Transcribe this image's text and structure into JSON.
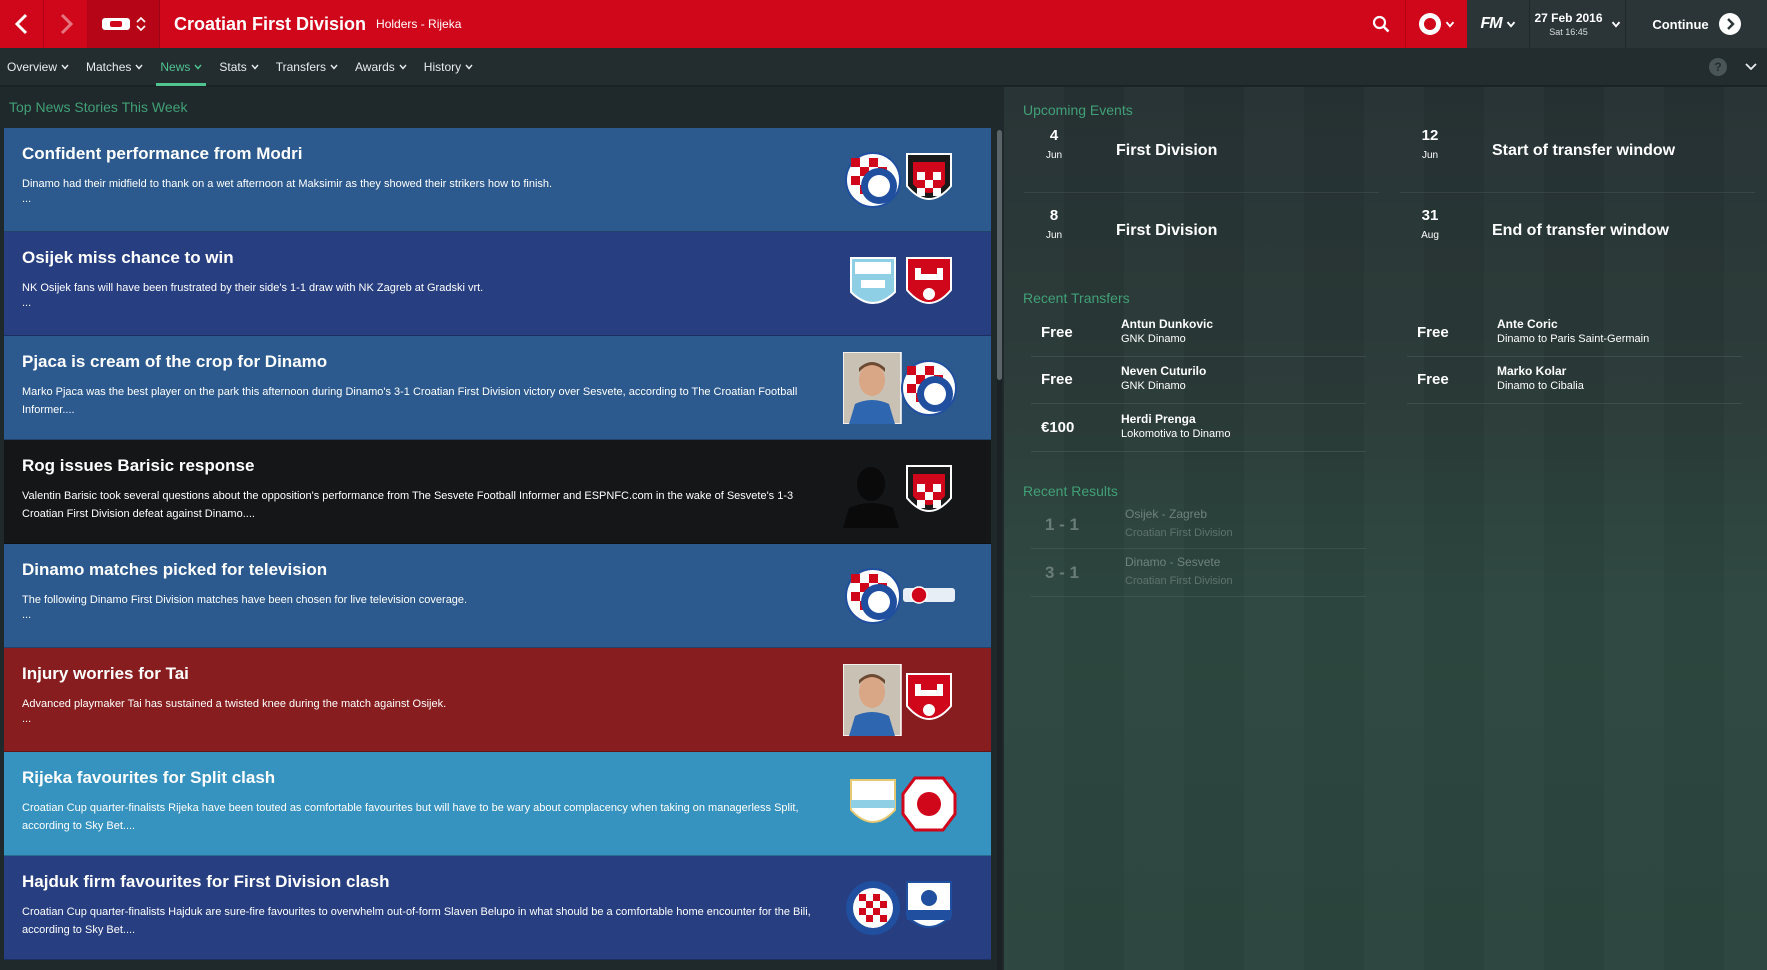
{
  "colors": {
    "accent_red": "#d0061b",
    "accent_green": "#41a077"
  },
  "header": {
    "title": "Croatian First Division",
    "subtitle": "Holders - Rijeka",
    "date": "27 Feb 2016",
    "time": "Sat 16:45",
    "continue_label": "Continue",
    "logo_text": "FM"
  },
  "tabs": [
    {
      "label": "Overview"
    },
    {
      "label": "Matches"
    },
    {
      "label": "News",
      "active": true
    },
    {
      "label": "Stats"
    },
    {
      "label": "Transfers"
    },
    {
      "label": "Awards"
    },
    {
      "label": "History"
    }
  ],
  "help_label": "?",
  "news": {
    "title": "Top News Stories This Week",
    "items": [
      {
        "headline": "Confident performance from Modri",
        "body": "Dinamo had their midfield to thank on a wet afternoon at Maksimir as they showed their strikers how to finish.",
        "more": "...",
        "color": "#2c5a8e",
        "images": [
          "dinamo-crest",
          "sesvete-crest"
        ]
      },
      {
        "headline": "Osijek miss chance to win",
        "body": "NK Osijek fans will have been frustrated by their side's 1-1 draw with NK Zagreb at Gradski vrt.",
        "more": "...",
        "color": "#273e80",
        "images": [
          "osijek-crest",
          "zagreb-crest"
        ]
      },
      {
        "headline": "Pjaca is cream of the crop for Dinamo",
        "body": "Marko Pjaca was the best player on the park this afternoon during Dinamo's 3-1 Croatian First Division victory over Sesvete, according to The Croatian Football Informer....",
        "more": "",
        "color": "#2c5a8e",
        "images": [
          "player-photo",
          "dinamo-crest"
        ]
      },
      {
        "headline": "Rog issues Barisic response",
        "body": "Valentin Barisic took several questions about the opposition's performance from The Sesvete Football Informer and ESPNFC.com in the wake of Sesvete's 1-3 Croatian First Division defeat against Dinamo....",
        "more": "",
        "color": "#151617",
        "images": [
          "silhouette",
          "sesvete-crest"
        ]
      },
      {
        "headline": "Dinamo matches picked for television",
        "body": "The following Dinamo First Division matches have been chosen for live television coverage.",
        "more": "...",
        "color": "#2c5a8e",
        "images": [
          "dinamo-crest",
          "tv-logo"
        ]
      },
      {
        "headline": "Injury worries for Tai",
        "body": "Advanced playmaker Tai has sustained a twisted knee during the match against Osijek.",
        "more": "...",
        "color": "#881d1f",
        "images": [
          "player-photo",
          "zagreb-crest"
        ]
      },
      {
        "headline": "Rijeka favourites for Split clash",
        "body": "Croatian Cup quarter-finalists Rijeka have been touted as comfortable favourites but will have to be wary about complacency when taking on managerless Split, according to Sky Bet....",
        "more": "",
        "color": "#3692bf",
        "images": [
          "rijeka-crest",
          "split-crest"
        ]
      },
      {
        "headline": "Hajduk firm favourites for First Division clash",
        "body": "Croatian Cup quarter-finalists Hajduk are sure-fire favourites to overwhelm out-of-form Slaven Belupo in what should be a comfortable home encounter for the Bili, according to Sky Bet....",
        "more": "",
        "color": "#273e80",
        "images": [
          "hajduk-crest",
          "slaven-crest"
        ]
      }
    ]
  },
  "events": {
    "title": "Upcoming Events",
    "items": [
      {
        "day": "4",
        "month": "Jun",
        "name": "First Division"
      },
      {
        "day": "12",
        "month": "Jun",
        "name": "Start of transfer window"
      },
      {
        "day": "8",
        "month": "Jun",
        "name": "First Division"
      },
      {
        "day": "31",
        "month": "Aug",
        "name": "End of transfer window"
      }
    ]
  },
  "transfers": {
    "title": "Recent Transfers",
    "items": [
      {
        "fee": "Free",
        "player": "Antun Dunkovic",
        "detail": "GNK Dinamo"
      },
      {
        "fee": "Free",
        "player": "Ante Coric",
        "detail": "Dinamo to Paris Saint-Germain"
      },
      {
        "fee": "Free",
        "player": "Neven Cuturilo",
        "detail": "GNK Dinamo"
      },
      {
        "fee": "Free",
        "player": "Marko Kolar",
        "detail": "Dinamo to Cibalia"
      },
      {
        "fee": "€100",
        "player": "Herdi Prenga",
        "detail": "Lokomotiva to Dinamo"
      }
    ]
  },
  "results": {
    "title": "Recent Results",
    "items": [
      {
        "score": "1 - 1",
        "teams": "Osijek - Zagreb",
        "competition": "Croatian First Division"
      },
      {
        "score": "3 - 1",
        "teams": "Dinamo - Sesvete",
        "competition": "Croatian First Division"
      }
    ]
  }
}
